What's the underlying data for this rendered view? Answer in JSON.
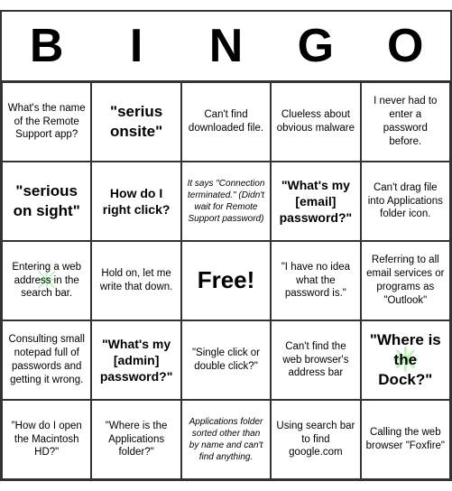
{
  "header": {
    "letters": [
      "B",
      "I",
      "N",
      "G",
      "O"
    ]
  },
  "cells": [
    {
      "text": "What's the name of the Remote Support app?",
      "style": "normal"
    },
    {
      "text": "\"serius onsite\"",
      "style": "large-text"
    },
    {
      "text": "Can't find downloaded file.",
      "style": "normal"
    },
    {
      "text": "Clueless about obvious malware",
      "style": "normal"
    },
    {
      "text": "I never had to enter a password before.",
      "style": "normal"
    },
    {
      "text": "\"serious on sight\"",
      "style": "large-text"
    },
    {
      "text": "How do I right click?",
      "style": "medium-text"
    },
    {
      "text": "It says \"Connection terminated.\" (Didn't wait for Remote Support password)",
      "style": "small-italic"
    },
    {
      "text": "\"What's my [email] password?\"",
      "style": "medium-text"
    },
    {
      "text": "Can't drag file into Applications folder icon.",
      "style": "normal"
    },
    {
      "text": "Entering a web address in the search bar.",
      "style": "normal",
      "star": true
    },
    {
      "text": "Hold on, let me write that down.",
      "style": "normal"
    },
    {
      "text": "Free!",
      "style": "free"
    },
    {
      "text": "\"I have no idea what the password is.\"",
      "style": "normal"
    },
    {
      "text": "Referring to all email services or programs as \"Outlook\"",
      "style": "normal"
    },
    {
      "text": "Consulting small notepad full of passwords and getting it wrong.",
      "style": "normal"
    },
    {
      "text": "\"What's my [admin] password?\"",
      "style": "medium-text"
    },
    {
      "text": "\"Single click or double click?\"",
      "style": "normal"
    },
    {
      "text": "Can't find the web browser's address bar",
      "style": "normal"
    },
    {
      "text": "\"Where is the Dock?\"",
      "style": "large-text",
      "star": true
    },
    {
      "text": "\"How do I open the Macintosh HD?\"",
      "style": "normal"
    },
    {
      "text": "\"Where is the Applications folder?\"",
      "style": "normal"
    },
    {
      "text": "Applications folder sorted other than by name and can't find anything.",
      "style": "small-italic"
    },
    {
      "text": "Using search bar to find google.com",
      "style": "normal"
    },
    {
      "text": "Calling the web browser \"Foxfire\"",
      "style": "normal"
    }
  ]
}
